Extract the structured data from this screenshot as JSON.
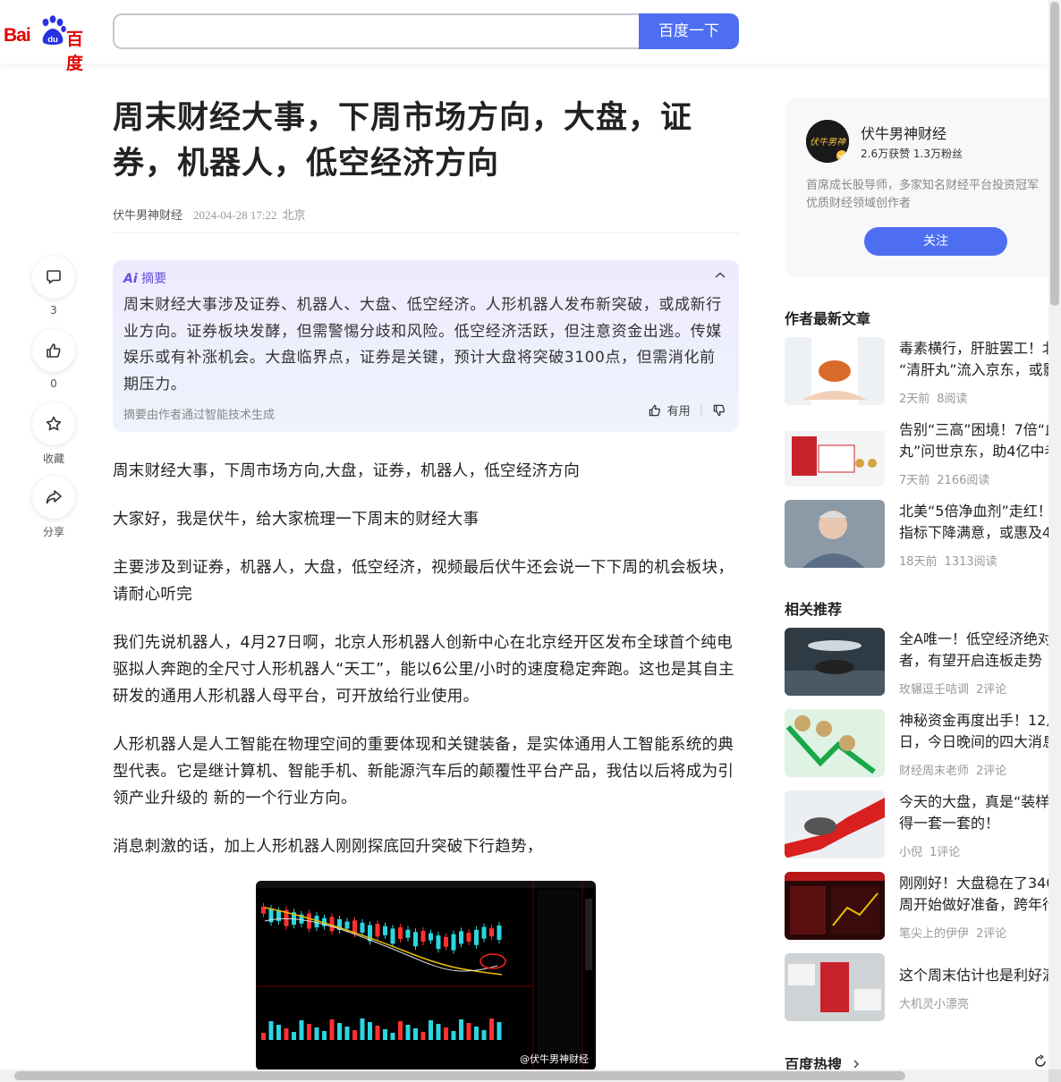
{
  "header": {
    "logo_text_left": "Bai",
    "logo_text_mid": "du",
    "logo_text_right": "百度",
    "search_placeholder": "",
    "search_button": "百度一下"
  },
  "article": {
    "title": "周末财经大事，下周市场方向，大盘，证券，机器人，低空经济方向",
    "author": "伏牛男神财经",
    "date": "2024-04-28 17:22",
    "location": "北京",
    "paragraphs": [
      "周末财经大事，下周市场方向,大盘，证券，机器人，低空经济方向",
      "大家好，我是伏牛，给大家梳理一下周末的财经大事",
      "主要涉及到证券，机器人，大盘，低空经济，视频最后伏牛还会说一下下周的机会板块，请耐心听完",
      "我们先说机器人，4月27日啊，北京人形机器人创新中心在北京经开区发布全球首个纯电驱拟人奔跑的全尺寸人形机器人“天工”，能以6公里/小时的速度稳定奔跑。这也是其自主研发的通用人形机器人母平台，可开放给行业使用。",
      "人形机器人是人工智能在物理空间的重要体现和关键装备，是实体通用人工智能系统的典型代表。它是继计算机、智能手机、新能源汽车后的颠覆性平台产品，我估以后将成为引领产业升级的 新的一个行业方向。",
      "消息刺激的话，加上人形机器人刚刚探底回升突破下行趋势，"
    ],
    "image_watermark": "@伏牛男神财经"
  },
  "summary": {
    "label_ai": "Ai",
    "label": "摘要",
    "text": "周末财经大事涉及证券、机器人、大盘、低空经济。人形机器人发布新突破，或成新行业方向。证券板块发酵，但需警惕分歧和风险。低空经济活跃，但注意资金出逃。传媒娱乐或有补涨机会。大盘临界点，证券是关键，预计大盘将突破3100点，但需消化前期压力。",
    "footer": "摘要由作者通过智能技术生成",
    "useful": "有用"
  },
  "side_actions": [
    {
      "name": "comment",
      "count": "3"
    },
    {
      "name": "like",
      "count": "0"
    },
    {
      "name": "favorite",
      "count": "收藏"
    },
    {
      "name": "share",
      "count": "分享"
    }
  ],
  "author_card": {
    "avatar_text": "伏牛男神",
    "name": "伏牛男神财经",
    "stats": "2.6万获赞 1.3万粉丝",
    "desc": "首席成长股导师，多家知名财经平台投资冠军优质财经领域创作者",
    "follow": "关注"
  },
  "latest": {
    "title": "作者最新文章",
    "items": [
      {
        "title1": "毒素横行，肝脏罢工！北",
        "title2": "“清肝丸”流入京东，或影",
        "time": "2天前",
        "stat": "8阅读"
      },
      {
        "title1": "告别“三高”困境！7倍“血",
        "title2": "丸”问世京东，助4亿中老",
        "time": "7天前",
        "stat": "2166阅读"
      },
      {
        "title1": "北美“5倍净血剂”走红！",
        "title2": "指标下降满意，或惠及4",
        "time": "18天前",
        "stat": "1313阅读"
      }
    ]
  },
  "related": {
    "title": "相关推荐",
    "items": [
      {
        "title1": "全A唯一！低空经济绝对",
        "title2": "者，有望开启连板走势",
        "source": "玫辗逗壬咭调",
        "stat": "2评论"
      },
      {
        "title1": "神秘资金再度出手！12月",
        "title2": "日，今日晚间的四大消息",
        "source": "财经周末老师",
        "stat": "2评论"
      },
      {
        "title1": "今天的大盘，真是“装样",
        "title2": "得一套一套的！",
        "source": "小倪",
        "stat": "1评论"
      },
      {
        "title1": "刚刚好！大盘稳在了340",
        "title2": "周开始做好准备，跨年行",
        "source": "笔尖上的伊伊",
        "stat": "2评论"
      },
      {
        "title1": "这个周末估计也是利好满",
        "title2": "",
        "source": "大机灵小漂亮",
        "stat": ""
      }
    ]
  },
  "hot": {
    "title": "百度热搜"
  },
  "colors": {
    "brand_red": "#e10601",
    "brand_blue": "#4e6ef2",
    "ai_purple": "#6a4ee0"
  }
}
